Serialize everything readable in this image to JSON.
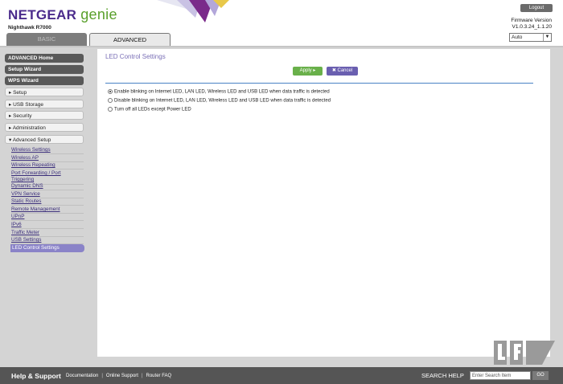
{
  "header": {
    "brand_netgear": "NETGEAR",
    "brand_genie": "genie",
    "model": "Nighthawk R7000",
    "tabs": [
      {
        "label": "BASIC"
      },
      {
        "label": "ADVANCED"
      }
    ],
    "logout_label": "Logout",
    "firmware_label": "Firmware Version",
    "firmware_value": "V1.0.3.24_1.1.20",
    "language_selected": "Auto"
  },
  "sidebar": {
    "top_buttons": [
      {
        "label": "ADVANCED Home"
      },
      {
        "label": "Setup Wizard"
      },
      {
        "label": "WPS Wizard"
      }
    ],
    "sections": [
      {
        "label": "▸ Setup"
      },
      {
        "label": "▸ USB Storage"
      },
      {
        "label": "▸ Security"
      },
      {
        "label": "▸ Administration"
      },
      {
        "label": "▾ Advanced Setup"
      }
    ],
    "subitems": [
      {
        "label": "Wireless Settings"
      },
      {
        "label": "Wireless AP"
      },
      {
        "label": "Wireless Repeating"
      },
      {
        "label": "Port Forwarding / Port Triggering"
      },
      {
        "label": "Dynamic DNS"
      },
      {
        "label": "VPN Service"
      },
      {
        "label": "Static Routes"
      },
      {
        "label": "Remote Management"
      },
      {
        "label": "UPnP"
      },
      {
        "label": "IPv6"
      },
      {
        "label": "Traffic Meter"
      },
      {
        "label": "USB Settings"
      }
    ],
    "active_item": "LED Control Settings"
  },
  "main": {
    "title": "LED Control Settings",
    "apply_label": "Apply ▸",
    "cancel_label": "✖ Cancel",
    "options": [
      {
        "label": "Enable blinking on Internet LED, LAN LED, Wireless LED and USB LED when data traffic is detected",
        "selected": true
      },
      {
        "label": "Disable blinking on Internet LED, LAN LED, Wireless LED and USB LED when data traffic is detected",
        "selected": false
      },
      {
        "label": "Turn off all LEDs except Power LED",
        "selected": false
      }
    ]
  },
  "footer": {
    "title": "Help & Support",
    "links": [
      {
        "label": "Documentation"
      },
      {
        "label": "Online Support"
      },
      {
        "label": "Router FAQ"
      }
    ],
    "search_label": "SEARCH HELP",
    "search_placeholder": "Enter Search Item",
    "go_label": "GO"
  },
  "watermark": "Legit Reviews",
  "colors": {
    "brand_purple": "#4b2b8c",
    "brand_green": "#5aa02c",
    "apply_green": "#69b04a",
    "cancel_purple": "#6a5fb0",
    "active_item": "#8a83c8"
  }
}
